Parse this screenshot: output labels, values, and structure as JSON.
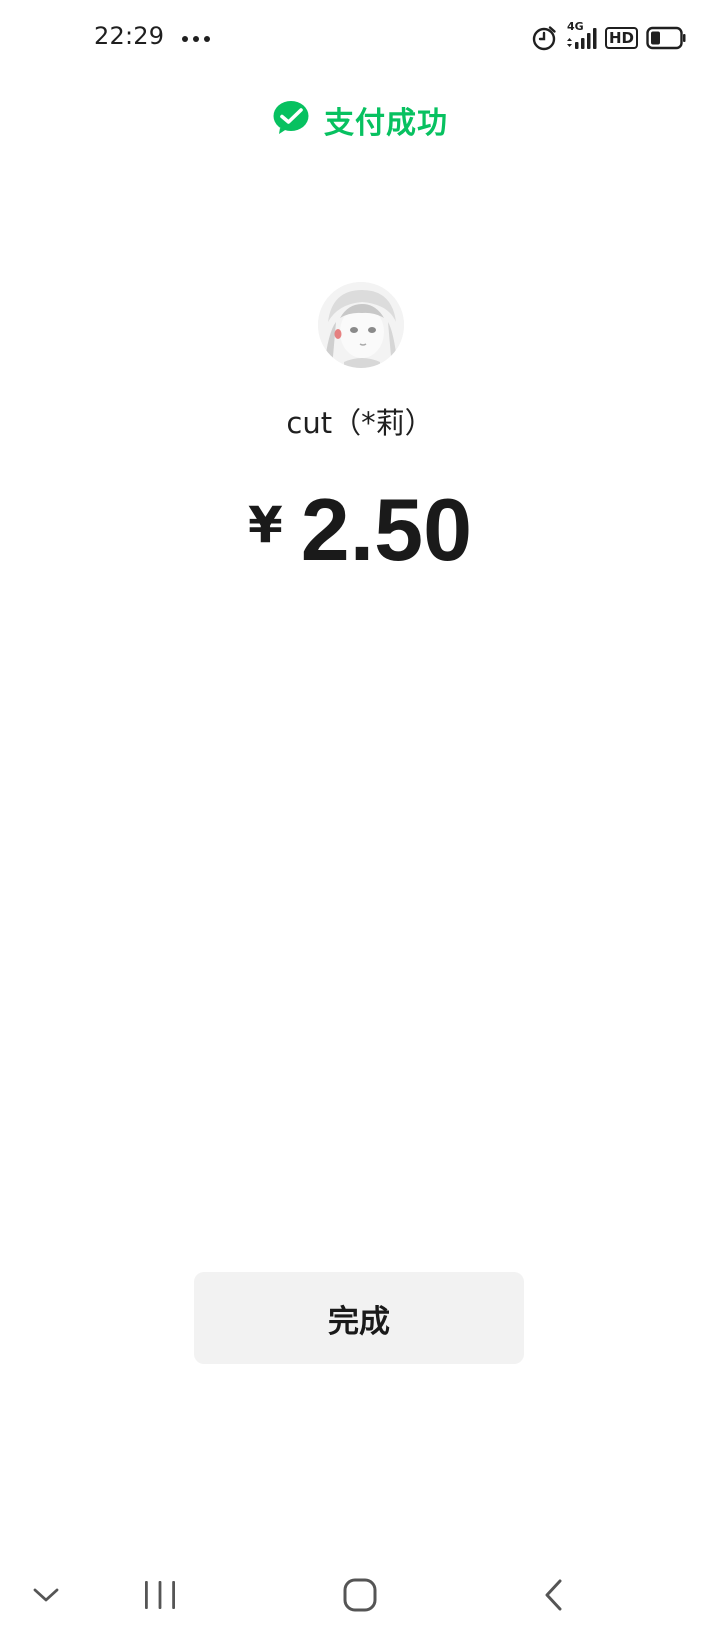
{
  "status_bar": {
    "time": "22:29",
    "network": "4G",
    "hd_label": "HD",
    "icons": [
      "more-dots-icon",
      "alarm-icon",
      "signal-icon",
      "hd-icon",
      "battery-icon"
    ]
  },
  "header": {
    "title": "支付成功",
    "icon": "wechat-pay-check-icon",
    "accent_color": "#07c160"
  },
  "payee": {
    "avatar": "avatar",
    "name": "cut（*莉）"
  },
  "payment": {
    "currency_symbol": "¥",
    "amount": "2.50"
  },
  "actions": {
    "done_label": "完成"
  },
  "nav_bar": {
    "icons": [
      "collapse-chevron-icon",
      "recent-apps-icon",
      "home-icon",
      "back-icon"
    ]
  }
}
